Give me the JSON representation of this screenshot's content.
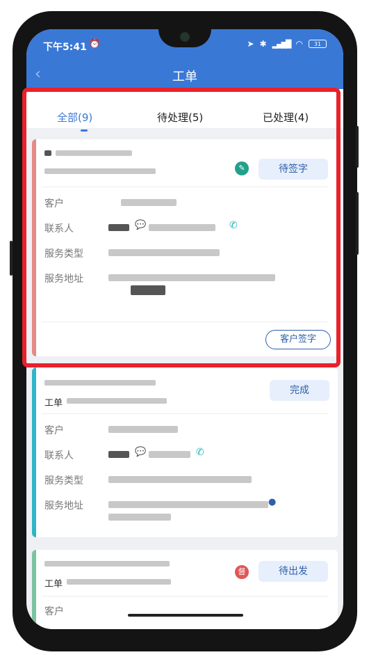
{
  "status_bar": {
    "time": "下午5:41",
    "battery": "31"
  },
  "app_bar": {
    "title": "工单"
  },
  "tabs": [
    {
      "label": "全部(9)",
      "active": true
    },
    {
      "label": "待处理(5)",
      "active": false
    },
    {
      "label": "已处理(4)",
      "active": false
    }
  ],
  "field_labels": {
    "customer": "客户",
    "contact": "联系人",
    "service_type": "服务类型",
    "address": "服务地址",
    "order_prefix": "工单"
  },
  "cards": [
    {
      "status": "待签字",
      "action": "客户签字",
      "stripe_color": "#e58a86"
    },
    {
      "status": "完成",
      "stripe_color": "#2fb6c8"
    },
    {
      "status": "待出发",
      "badge": "督",
      "stripe_color": "#7bc3a1"
    }
  ],
  "colors": {
    "primary": "#3a78d6",
    "highlight": "#e8212b"
  }
}
